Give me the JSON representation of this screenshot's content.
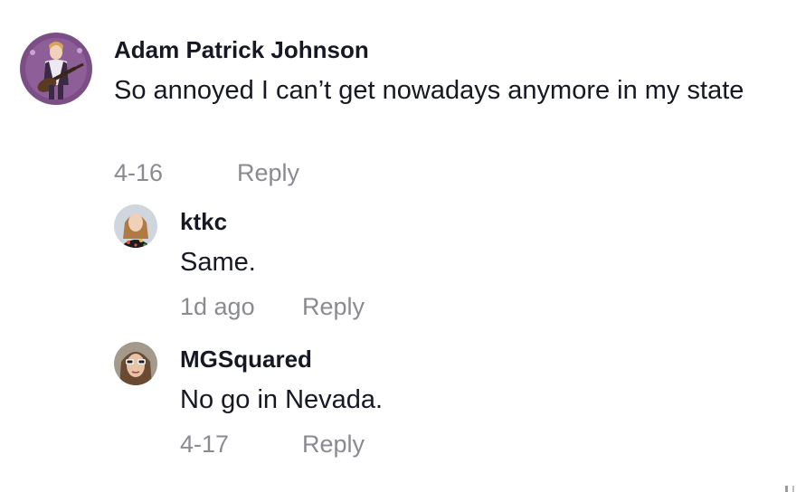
{
  "comments": [
    {
      "author": "Adam Patrick Johnson",
      "avatar_icon": "guitarist-illustration-avatar",
      "text": "So annoyed I can’t get nowadays anymore in my state",
      "date": "4-16",
      "reply_label": "Reply",
      "replies": [
        {
          "author": "ktkc",
          "avatar_icon": "woman-portrait-avatar",
          "text": "Same.",
          "date": "1d ago",
          "reply_label": "Reply"
        },
        {
          "author": "MGSquared",
          "avatar_icon": "sunglasses-portrait-avatar",
          "text": "No go in Nevada.",
          "date": "4-17",
          "reply_label": "Reply"
        }
      ]
    }
  ],
  "colors": {
    "text": "#161823",
    "muted": "#8a8b91",
    "background": "#ffffff"
  }
}
